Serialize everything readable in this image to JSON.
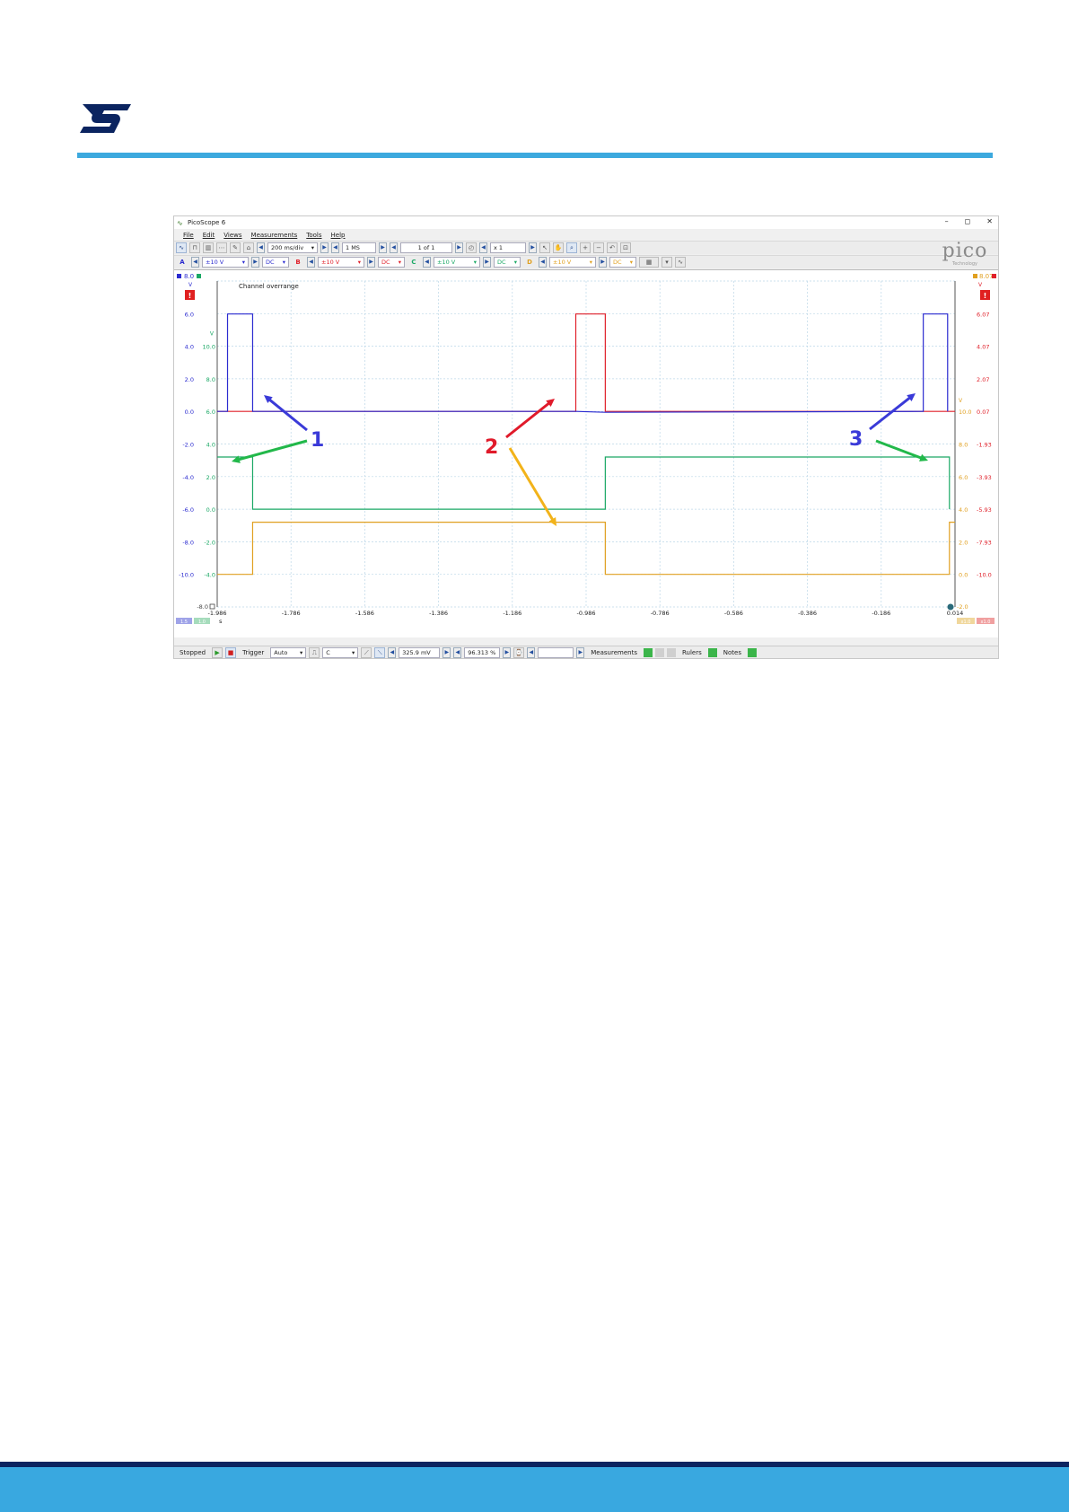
{
  "document": {
    "brand": "ST"
  },
  "window": {
    "app_title": "PicoScope 6",
    "minimize": "–",
    "maximize": "◻",
    "close": "✕"
  },
  "menu": [
    "File",
    "Edit",
    "Views",
    "Measurements",
    "Tools",
    "Help"
  ],
  "toolbar": {
    "timebase": "200 ms/div",
    "samples": "1 MS",
    "buffer": "1 of 1",
    "zoom": "x 1"
  },
  "channels": [
    {
      "label": "A",
      "range": "±10 V",
      "coupling": "DC",
      "color": "#2b2bd0"
    },
    {
      "label": "B",
      "range": "±10 V",
      "coupling": "DC",
      "color": "#e0202a"
    },
    {
      "label": "C",
      "range": "±10 V",
      "coupling": "DC",
      "color": "#1aa865"
    },
    {
      "label": "D",
      "range": "±10 V",
      "coupling": "DC",
      "color": "#e0a020"
    }
  ],
  "pico_logo": {
    "name": "pico",
    "sub": "Technology"
  },
  "scope": {
    "overrange_text": "Channel overrange",
    "top_left_value": "8.0",
    "top_right_value": "8.07",
    "unit": "V",
    "x_unit": "s",
    "left_offset_label": "-8.0",
    "right_bottom_label": "-2.0",
    "axis_blue": [
      "6.0",
      "4.0",
      "2.0",
      "0.0",
      "-2.0",
      "-4.0",
      "-6.0",
      "-8.0",
      "-10.0"
    ],
    "axis_green": [
      "10.0",
      "8.0",
      "6.0",
      "4.0",
      "2.0",
      "0.0",
      "-2.0",
      "-4.0"
    ],
    "axis_orange": [
      "10.0",
      "8.0",
      "6.0",
      "4.0",
      "2.0",
      "0.0"
    ],
    "axis_red": [
      "6.07",
      "4.07",
      "2.07",
      "0.07",
      "-1.93",
      "-3.93",
      "-5.93",
      "-7.93",
      "-10.0"
    ],
    "x_ticks": [
      "-1.986",
      "-1.786",
      "-1.586",
      "-1.386",
      "-1.186",
      "-0.986",
      "-0.786",
      "-0.586",
      "-0.386",
      "-0.186",
      "0.014"
    ],
    "annotations": [
      "1",
      "2",
      "3"
    ],
    "footer_left": [
      "1.5",
      "1.0"
    ],
    "footer_right": [
      "x1.0",
      "x1.0"
    ]
  },
  "statusbar": {
    "state": "Stopped",
    "trigger_label": "Trigger",
    "trigger_mode": "Auto",
    "trigger_source": "C",
    "threshold": "325.9 mV",
    "pretrigger": "96.313 %",
    "measurements": "Measurements",
    "rulers": "Rulers",
    "notes": "Notes"
  },
  "colors": {
    "blue": "#2b2bd0",
    "red": "#e0202a",
    "green": "#1aa865",
    "orange": "#e0a020",
    "st_blue": "#3ca9de",
    "st_navy": "#0b2460"
  }
}
